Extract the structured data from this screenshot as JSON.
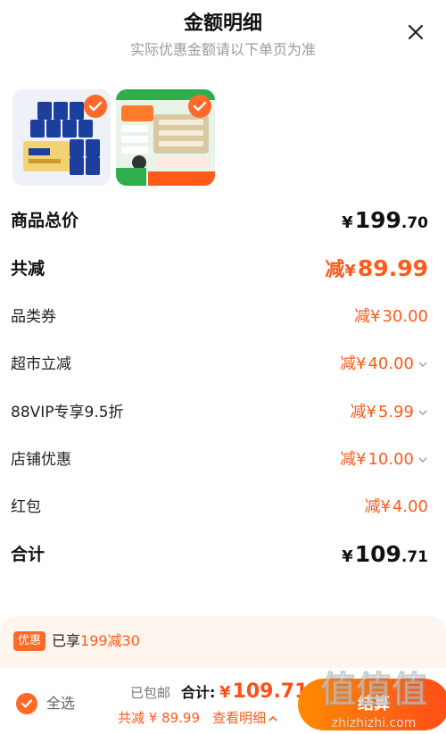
{
  "header": {
    "title": "金额明细",
    "subtitle": "实际优惠金额请以下单页为准"
  },
  "rows": {
    "goods_total": {
      "label": "商品总价",
      "sym": "¥",
      "int": "199",
      "dec": ".70"
    },
    "total_discount": {
      "label": "共减",
      "prefix": "减",
      "sym": "¥",
      "int": "89",
      "dec": ".99"
    },
    "category_coupon": {
      "label": "品类券",
      "prefix": "减",
      "sym": "¥",
      "amount": "30.00"
    },
    "supermarket_cut": {
      "label": "超市立减",
      "prefix": "减",
      "sym": "¥",
      "amount": "40.00"
    },
    "vip_discount": {
      "label": "88VIP专享9.5折",
      "prefix": "减",
      "sym": "¥",
      "amount": "5.99"
    },
    "store_promo": {
      "label": "店铺优惠",
      "prefix": "减",
      "sym": "¥",
      "amount": "10.00"
    },
    "red_packet": {
      "label": "红包",
      "prefix": "减",
      "sym": "¥",
      "amount": "4.00"
    },
    "sum": {
      "label": "合计",
      "sym": "¥",
      "int": "109",
      "dec": ".71"
    }
  },
  "promo": {
    "badge": "优惠",
    "text_prefix": "已享",
    "text_highlight": "199减30"
  },
  "bottom": {
    "select_all": "全选",
    "shipping": "已包邮",
    "total_label": "合计:",
    "total_sym": "¥",
    "total_value": "109.71",
    "discount_line": "共减 ¥ 89.99",
    "detail_link": "查看明细",
    "settle": "结算"
  },
  "colors": {
    "accent": "#ff5a1a",
    "promo_bg": "#fff5ef"
  },
  "watermark": {
    "glyphs": "值值值",
    "site": "zhizhizhi.com"
  }
}
